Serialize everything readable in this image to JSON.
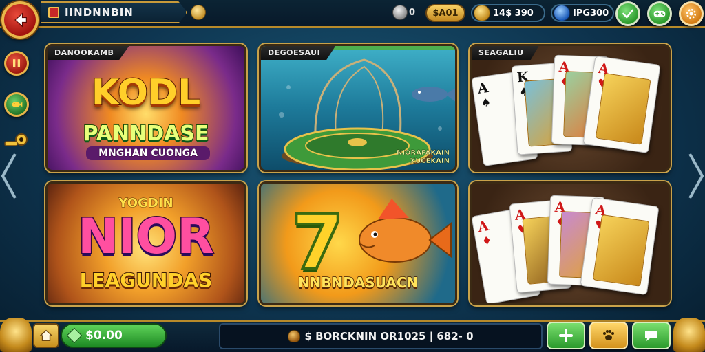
{
  "header": {
    "title": "IINDNNBIN",
    "silver_value": "0",
    "gold_value": "$A01",
    "coins_value": "14$ 390",
    "gems_value": "IPG300"
  },
  "tiles": [
    {
      "tab": "DANOOKAMB",
      "line1": "KODL",
      "line2": "PANNDASE",
      "line3": "MNGHAN CUONGA"
    },
    {
      "tab": "DEGOESAUI",
      "caption1": "NIORAFAKAIN",
      "caption2": "XUCEKAIN"
    },
    {
      "tab": "SEAGALIU"
    },
    {
      "line1": "YOGDIN",
      "line2": "NIOR",
      "line3": "LEAGUNDAS"
    },
    {
      "big_number": "7",
      "caption": "NNBNDASUACN"
    },
    {}
  ],
  "cards_top": [
    {
      "rank": "A",
      "suit": "♠",
      "color": "black"
    },
    {
      "rank": "K",
      "suit": "♠",
      "color": "black"
    },
    {
      "rank": "A",
      "suit": "♦",
      "color": "red"
    },
    {
      "rank": "A",
      "suit": "♥",
      "color": "red"
    }
  ],
  "cards_bottom": [
    {
      "rank": "A",
      "suit": "♦",
      "color": "red"
    },
    {
      "rank": "A",
      "suit": "♥",
      "color": "red"
    },
    {
      "rank": "A",
      "suit": "♦",
      "color": "red"
    },
    {
      "rank": "A",
      "suit": "♥",
      "color": "red"
    }
  ],
  "footer": {
    "balance": "$0.00",
    "status_text": "$ BORCKNIN OR1025 | 682- 0"
  },
  "icons": {
    "back": "back-arrow-icon",
    "pause": "pause-icon",
    "fish": "fish-icon",
    "key": "key-icon",
    "gamepad": "gamepad-icon",
    "settings": "gear-icon",
    "home": "home-icon",
    "plus": "plus-icon",
    "paw": "paw-icon",
    "chat": "chat-icon"
  },
  "colors": {
    "accent_gold": "#c9a24a",
    "button_green": "#2b9a2c",
    "button_red": "#a3140f",
    "background": "#0e3550"
  }
}
